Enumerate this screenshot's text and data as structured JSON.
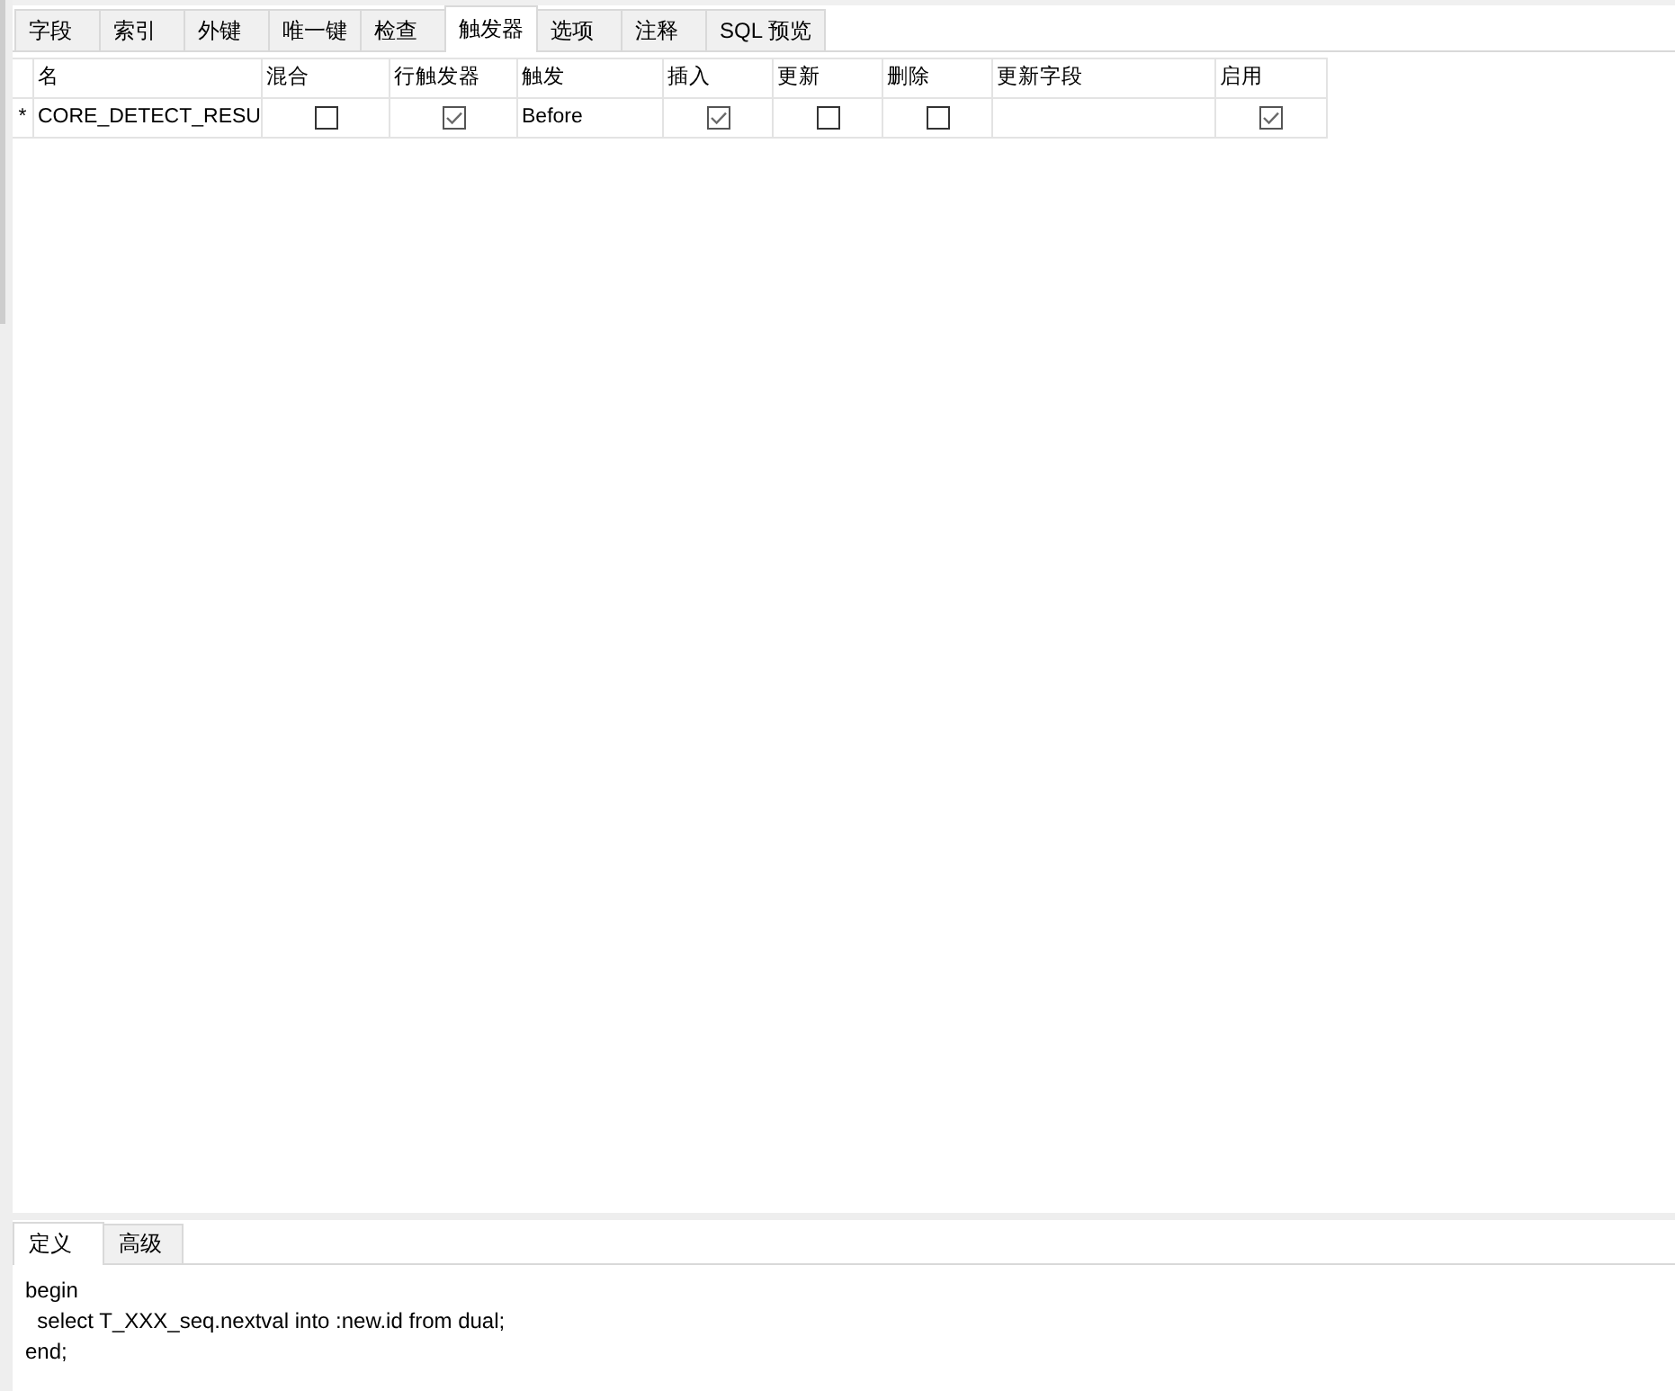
{
  "tabs": [
    {
      "label": "字段",
      "selected": false
    },
    {
      "label": "索引",
      "selected": false
    },
    {
      "label": "外键",
      "selected": false
    },
    {
      "label": "唯一键",
      "selected": false
    },
    {
      "label": "检查",
      "selected": false
    },
    {
      "label": "触发器",
      "selected": true
    },
    {
      "label": "选项",
      "selected": false
    },
    {
      "label": "注释",
      "selected": false
    },
    {
      "label": "SQL 预览",
      "selected": false
    }
  ],
  "trigger_table": {
    "columns": [
      "名",
      "混合",
      "行触发器",
      "触发",
      "插入",
      "更新",
      "删除",
      "更新字段",
      "启用"
    ],
    "rows": [
      {
        "marker": "*",
        "cells": [
          {
            "kind": "text",
            "text": "CORE_DETECT_RESU"
          },
          {
            "kind": "check",
            "checked": false
          },
          {
            "kind": "check",
            "checked": true
          },
          {
            "kind": "text",
            "text": "Before"
          },
          {
            "kind": "check",
            "checked": true
          },
          {
            "kind": "check",
            "checked": false
          },
          {
            "kind": "check",
            "checked": false
          },
          {
            "kind": "text"
          },
          {
            "kind": "check",
            "checked": true
          }
        ]
      }
    ]
  },
  "editor_tabs": [
    {
      "label": "定义",
      "selected": true
    },
    {
      "label": "高级",
      "selected": false
    }
  ],
  "definition": {
    "lines": [
      "begin",
      "  select T_XXX_seq.nextval into :new.id from dual;",
      "end;"
    ]
  }
}
